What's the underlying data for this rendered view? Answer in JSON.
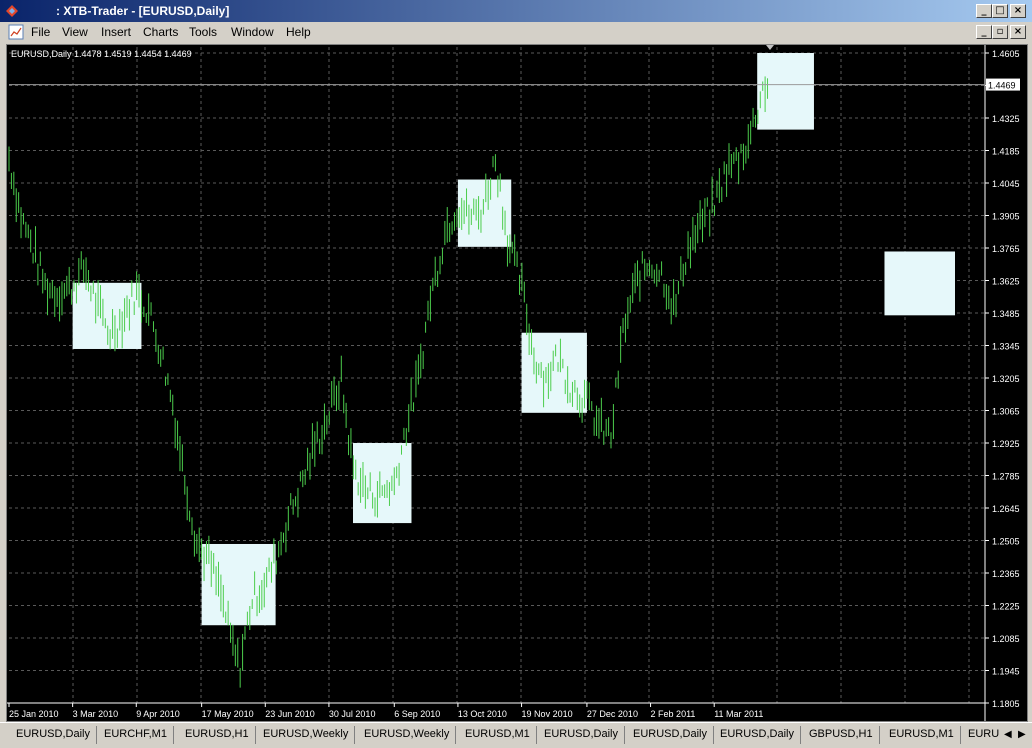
{
  "window": {
    "title": ": XTB-Trader - [EURUSD,Daily]",
    "controls": {
      "minimize": "_",
      "maximize": "□",
      "close": "×",
      "restore": "▫"
    }
  },
  "menu": [
    "File",
    "View",
    "Insert",
    "Charts",
    "Tools",
    "Window",
    "Help"
  ],
  "chart": {
    "header": "EURUSD,Daily  1.4478 1.4519 1.4454 1.4469",
    "current_price_label": "1.4469",
    "colors": {
      "background": "#000000",
      "grid": "#5a5a5a",
      "bars": "#4ccd4c",
      "box_fill": "#e6f8fa",
      "text": "#ffffff"
    }
  },
  "chart_data": {
    "type": "bar",
    "symbol": "EURUSD",
    "timeframe": "Daily",
    "ohlc_last": {
      "open": 1.4478,
      "high": 1.4519,
      "low": 1.4454,
      "close": 1.4469
    },
    "y_ticks": [
      "1.4605",
      "1.4465",
      "1.4325",
      "1.4185",
      "1.4045",
      "1.3905",
      "1.3765",
      "1.3625",
      "1.3485",
      "1.3345",
      "1.3205",
      "1.3065",
      "1.2925",
      "1.2785",
      "1.2645",
      "1.2505",
      "1.2365",
      "1.2225",
      "1.2085",
      "1.1945",
      "1.1805"
    ],
    "ylim": [
      1.1805,
      1.4605
    ],
    "x_ticks": [
      "25 Jan 2010",
      "3 Mar 2010",
      "9 Apr 2010",
      "17 May 2010",
      "23 Jun 2010",
      "30 Jul 2010",
      "6 Sep 2010",
      "13 Oct 2010",
      "19 Nov 2010",
      "27 Dec 2010",
      "2 Feb 2011",
      "11 Mar 2011"
    ],
    "grid": true,
    "price_path": [
      [
        "25 Jan 2010",
        1.415
      ],
      [
        "1 Feb 2010",
        1.39
      ],
      [
        "8 Feb 2010",
        1.376
      ],
      [
        "15 Feb 2010",
        1.36
      ],
      [
        "22 Feb 2010",
        1.357
      ],
      [
        "3 Mar 2010",
        1.36
      ],
      [
        "10 Mar 2010",
        1.368
      ],
      [
        "17 Mar 2010",
        1.352
      ],
      [
        "24 Mar 2010",
        1.34
      ],
      [
        "31 Mar 2010",
        1.345
      ],
      [
        "9 Apr 2010",
        1.358
      ],
      [
        "16 Apr 2010",
        1.35
      ],
      [
        "23 Apr 2010",
        1.333
      ],
      [
        "30 Apr 2010",
        1.31
      ],
      [
        "7 May 2010",
        1.278
      ],
      [
        "14 May 2010",
        1.25
      ],
      [
        "21 May 2010",
        1.242
      ],
      [
        "28 May 2010",
        1.228
      ],
      [
        "4 Jun 2010",
        1.205
      ],
      [
        "8 Jun 2010",
        1.195
      ],
      [
        "15 Jun 2010",
        1.225
      ],
      [
        "23 Jun 2010",
        1.232
      ],
      [
        "30 Jun 2010",
        1.245
      ],
      [
        "7 Jul 2010",
        1.262
      ],
      [
        "14 Jul 2010",
        1.275
      ],
      [
        "21 Jul 2010",
        1.29
      ],
      [
        "30 Jul 2010",
        1.305
      ],
      [
        "6 Aug 2010",
        1.32
      ],
      [
        "13 Aug 2010",
        1.282
      ],
      [
        "20 Aug 2010",
        1.272
      ],
      [
        "27 Aug 2010",
        1.27
      ],
      [
        "6 Sep 2010",
        1.275
      ],
      [
        "13 Sep 2010",
        1.3
      ],
      [
        "20 Sep 2010",
        1.32
      ],
      [
        "27 Sep 2010",
        1.355
      ],
      [
        "6 Oct 2010",
        1.385
      ],
      [
        "13 Oct 2010",
        1.395
      ],
      [
        "20 Oct 2010",
        1.39
      ],
      [
        "27 Oct 2010",
        1.393
      ],
      [
        "4 Nov 2010",
        1.415
      ],
      [
        "11 Nov 2010",
        1.38
      ],
      [
        "19 Nov 2010",
        1.36
      ],
      [
        "26 Nov 2010",
        1.33
      ],
      [
        "3 Dec 2010",
        1.32
      ],
      [
        "10 Dec 2010",
        1.33
      ],
      [
        "17 Dec 2010",
        1.318
      ],
      [
        "27 Dec 2010",
        1.31
      ],
      [
        "3 Jan 2011",
        1.3
      ],
      [
        "10 Jan 2011",
        1.295
      ],
      [
        "17 Jan 2011",
        1.34
      ],
      [
        "26 Jan 2011",
        1.365
      ],
      [
        "2 Feb 2011",
        1.37
      ],
      [
        "9 Feb 2011",
        1.365
      ],
      [
        "16 Feb 2011",
        1.35
      ],
      [
        "23 Feb 2011",
        1.375
      ],
      [
        "2 Mar 2011",
        1.385
      ],
      [
        "11 Mar 2011",
        1.395
      ],
      [
        "18 Mar 2011",
        1.41
      ],
      [
        "25 Mar 2011",
        1.415
      ],
      [
        "1 Apr 2011",
        1.425
      ],
      [
        "8 Apr 2011",
        1.445
      ],
      [
        "11 Apr 2011",
        1.4469
      ]
    ],
    "boxes": [
      {
        "from": "3 Mar 2010",
        "to": "12 Apr 2010",
        "high": 1.3615,
        "low": 1.333
      },
      {
        "from": "17 May 2010",
        "to": "29 Jun 2010",
        "high": 1.249,
        "low": 1.214
      },
      {
        "from": "13 Aug 2010",
        "to": "16 Sep 2010",
        "high": 1.2925,
        "low": 1.258
      },
      {
        "from": "13 Oct 2010",
        "to": "13 Nov 2010",
        "high": 1.406,
        "low": 1.377
      },
      {
        "from": "19 Nov 2010",
        "to": "27 Dec 2010",
        "high": 1.34,
        "low": 1.3055
      },
      {
        "from": "5 Apr 2011",
        "to": "8 May 2011",
        "high": 1.4605,
        "low": 1.4275
      },
      {
        "from": "18 Jun 2011",
        "to": "29 Jul 2011",
        "high": 1.375,
        "low": 1.3475
      }
    ]
  },
  "tabs": [
    "EURUSD,Daily",
    "EURCHF,M1",
    "EURUSD,H1",
    "EURUSD,Weekly",
    "EURUSD,Weekly",
    "EURUSD,M1",
    "EURUSD,Daily",
    "EURUSD,Daily",
    "EURUSD,Daily",
    "GBPUSD,H1",
    "EURUSD,M1",
    "EURU"
  ]
}
